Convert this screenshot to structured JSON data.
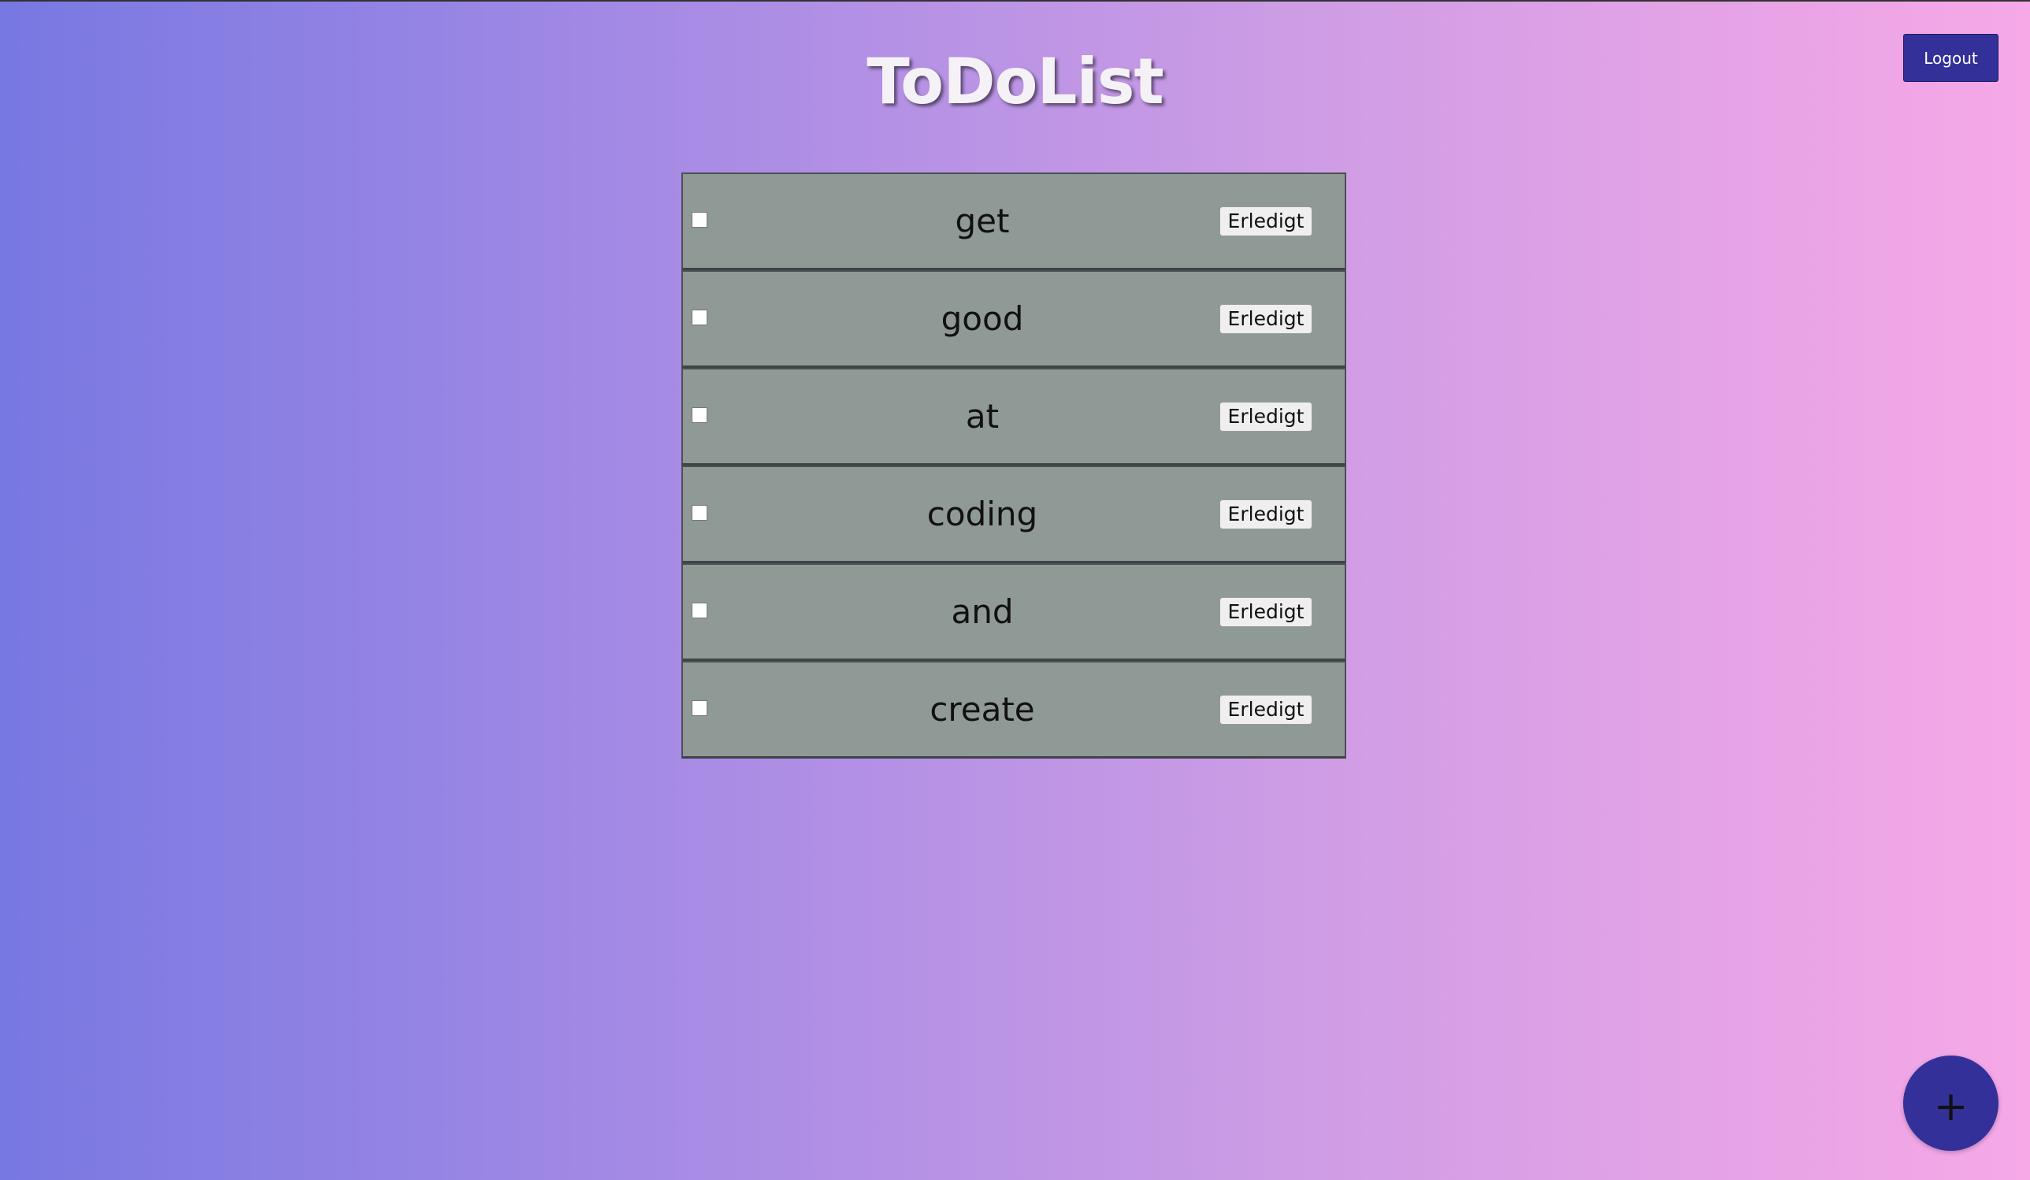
{
  "header": {
    "title": "ToDoList",
    "logout_label": "Logout"
  },
  "todos": [
    {
      "text": "get",
      "done_label": "Erledigt",
      "checked": false
    },
    {
      "text": "good",
      "done_label": "Erledigt",
      "checked": false
    },
    {
      "text": "at",
      "done_label": "Erledigt",
      "checked": false
    },
    {
      "text": "coding",
      "done_label": "Erledigt",
      "checked": false
    },
    {
      "text": "and",
      "done_label": "Erledigt",
      "checked": false
    },
    {
      "text": "create",
      "done_label": "Erledigt",
      "checked": false
    }
  ],
  "fab": {
    "label": "+",
    "icon": "plus-icon"
  },
  "colors": {
    "accent": "#33309a",
    "item_background": "#8f9995"
  }
}
